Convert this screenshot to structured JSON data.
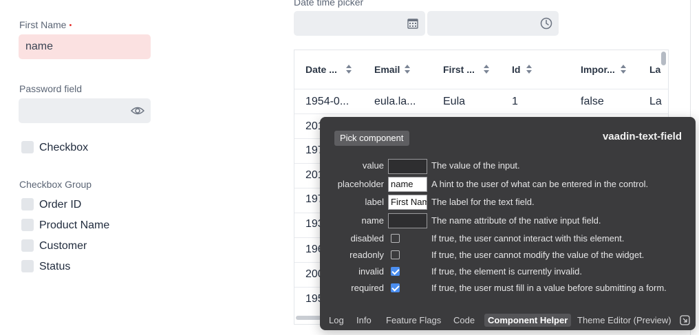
{
  "date_time_picker": {
    "label": "Date time picker",
    "date_icon": "calendar-icon",
    "time_icon": "clock-icon"
  },
  "first_name": {
    "label": "First Name",
    "required_marker": "•",
    "value": "name"
  },
  "password": {
    "label": "Password field",
    "icon": "eye-icon"
  },
  "checkbox": {
    "label": "Checkbox"
  },
  "checkbox_group": {
    "label": "Checkbox Group",
    "items": [
      "Order ID",
      "Product Name",
      "Customer",
      "Status"
    ]
  },
  "grid": {
    "headers": [
      "Date ...",
      "Email",
      "First ...",
      "Id",
      "Impor...",
      "La"
    ],
    "first_row": [
      "1954-0...",
      "eula.la...",
      "Eula",
      "1",
      "false",
      "La"
    ],
    "row_prefixes": [
      "201",
      "197",
      "201",
      "197",
      "193",
      "196",
      "200",
      "195"
    ]
  },
  "dev_panel": {
    "pick_button": "Pick component",
    "component_name": "vaadin-text-field",
    "properties": [
      {
        "name": "value",
        "type": "text",
        "value": "",
        "desc": "The value of the input."
      },
      {
        "name": "placeholder",
        "type": "text",
        "value": "name",
        "desc": "A hint to the user of what can be entered in the control."
      },
      {
        "name": "label",
        "type": "text",
        "value": "First Name",
        "desc": "The label for the text field."
      },
      {
        "name": "name",
        "type": "text",
        "value": "",
        "desc": "The name attribute of the native input field."
      },
      {
        "name": "disabled",
        "type": "checkbox",
        "checked": false,
        "desc": "If true, the user cannot interact with this element."
      },
      {
        "name": "readonly",
        "type": "checkbox",
        "checked": false,
        "desc": "If true, the user cannot modify the value of the widget."
      },
      {
        "name": "invalid",
        "type": "checkbox",
        "checked": true,
        "desc": "If true, the element is currently invalid."
      },
      {
        "name": "required",
        "type": "checkbox",
        "checked": true,
        "desc": "If true, the user must fill in a value before submitting a form."
      }
    ],
    "tabs": [
      "Log",
      "Info",
      "Feature Flags",
      "Code",
      "Component Helper",
      "Theme Editor (Preview)"
    ],
    "active_tab": "Component Helper",
    "corner_icon": "undock-icon"
  }
}
